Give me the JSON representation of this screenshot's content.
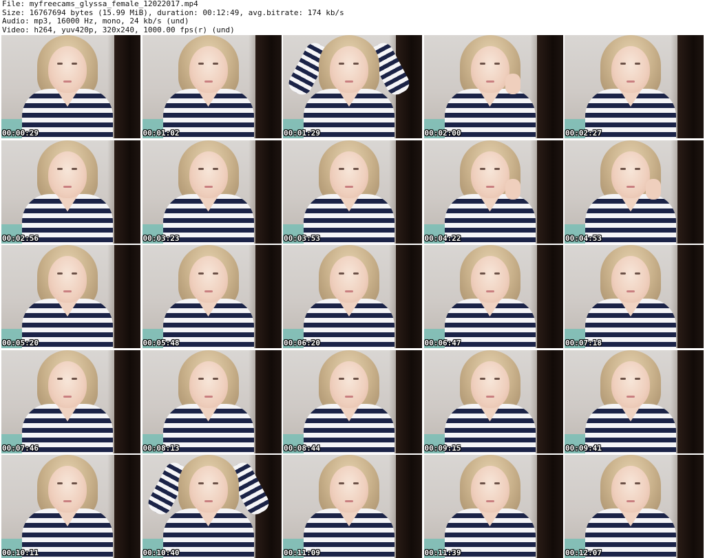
{
  "header": {
    "file_line": "File: myfreecams_glyssa_female_12022017.mp4",
    "size_line": "Size: 16767694 bytes (15.99 MiB), duration: 00:12:49, avg.bitrate: 174 kb/s",
    "audio_line": "Audio: mp3, 16000 Hz, mono, 24 kb/s (und)",
    "video_line": "Video: h264, yuv420p, 320x240, 1000.00 fps(r) (und)"
  },
  "thumbnails": [
    {
      "time": "00:00:29",
      "pose": "neutral"
    },
    {
      "time": "00:01:02",
      "pose": "neutral"
    },
    {
      "time": "00:01:29",
      "pose": "hands-up"
    },
    {
      "time": "00:02:00",
      "pose": "hand-chin"
    },
    {
      "time": "00:02:27",
      "pose": "neutral"
    },
    {
      "time": "00:02:56",
      "pose": "neutral"
    },
    {
      "time": "00:03:23",
      "pose": "neutral"
    },
    {
      "time": "00:03:53",
      "pose": "neutral"
    },
    {
      "time": "00:04:22",
      "pose": "hand-chin"
    },
    {
      "time": "00:04:53",
      "pose": "hand-chin"
    },
    {
      "time": "00:05:20",
      "pose": "neutral"
    },
    {
      "time": "00:05:48",
      "pose": "neutral"
    },
    {
      "time": "00:06:20",
      "pose": "neutral"
    },
    {
      "time": "00:06:47",
      "pose": "neutral"
    },
    {
      "time": "00:07:18",
      "pose": "neutral"
    },
    {
      "time": "00:07:46",
      "pose": "neutral"
    },
    {
      "time": "00:08:13",
      "pose": "neutral"
    },
    {
      "time": "00:08:44",
      "pose": "neutral"
    },
    {
      "time": "00:09:15",
      "pose": "neutral"
    },
    {
      "time": "00:09:41",
      "pose": "neutral"
    },
    {
      "time": "00:10:11",
      "pose": "neutral"
    },
    {
      "time": "00:10:40",
      "pose": "hands-up"
    },
    {
      "time": "00:11:09",
      "pose": "neutral"
    },
    {
      "time": "00:11:39",
      "pose": "neutral"
    },
    {
      "time": "00:12:07",
      "pose": "neutral"
    }
  ],
  "colors": {
    "page_background": "#ffffff",
    "header_text": "#111111",
    "timestamp_text": "#ffffff",
    "timestamp_outline": "#000000",
    "shirt_stripe_dark": "#1b2347",
    "shirt_stripe_light": "#f5f5f7"
  }
}
